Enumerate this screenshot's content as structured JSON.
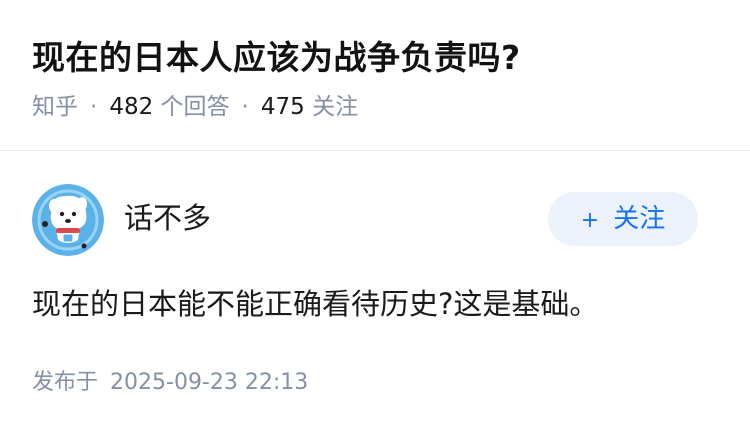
{
  "question": {
    "title": "现在的日本人应该为战争负责吗?",
    "source": "知乎",
    "answer_count": "482",
    "answer_label": "个回答",
    "follower_count": "475",
    "follower_label": "关注",
    "separator": "·"
  },
  "author": {
    "name": "话不多",
    "avatar_icon": "cartoon-avatar-icon",
    "follow_plus": "+",
    "follow_label": "关注"
  },
  "answer": {
    "content": "现在的日本能不能正确看待历史?这是基础。",
    "published_label": "发布于",
    "published_time": "2025-09-23 22:13"
  },
  "colors": {
    "accent": "#1772f6",
    "follow_bg": "#ebf2fb",
    "meta_gray": "#8590a6",
    "text": "#1a1a1a",
    "avatar_bg": "#5ab2e8"
  }
}
